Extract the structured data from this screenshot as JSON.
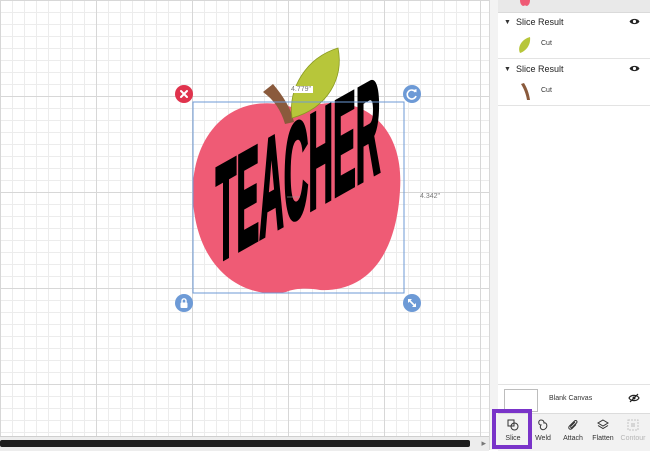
{
  "canvas": {
    "artwork_text": "TEACHER",
    "width_label": "4.779\"",
    "height_label": "4.342\""
  },
  "layers": [
    {
      "title": "Slice Result",
      "item_label": "Cut",
      "thumb": "leaf",
      "color": "#b7c63a"
    },
    {
      "title": "Slice Result",
      "item_label": "Cut",
      "thumb": "stem",
      "color": "#8a5a3c"
    }
  ],
  "blank_canvas": {
    "label": "Blank Canvas"
  },
  "toolbar": {
    "slice_label": "Slice",
    "weld_label": "Weld",
    "attach_label": "Attach",
    "flatten_label": "Flatten",
    "contour_label": "Contour"
  },
  "colors": {
    "apple": "#ef5b75",
    "leaf": "#b7c63a",
    "stem": "#8a5a3c",
    "selection": "#6d9ad6",
    "delete_handle": "#e0334d",
    "highlight": "#7a34c9"
  }
}
